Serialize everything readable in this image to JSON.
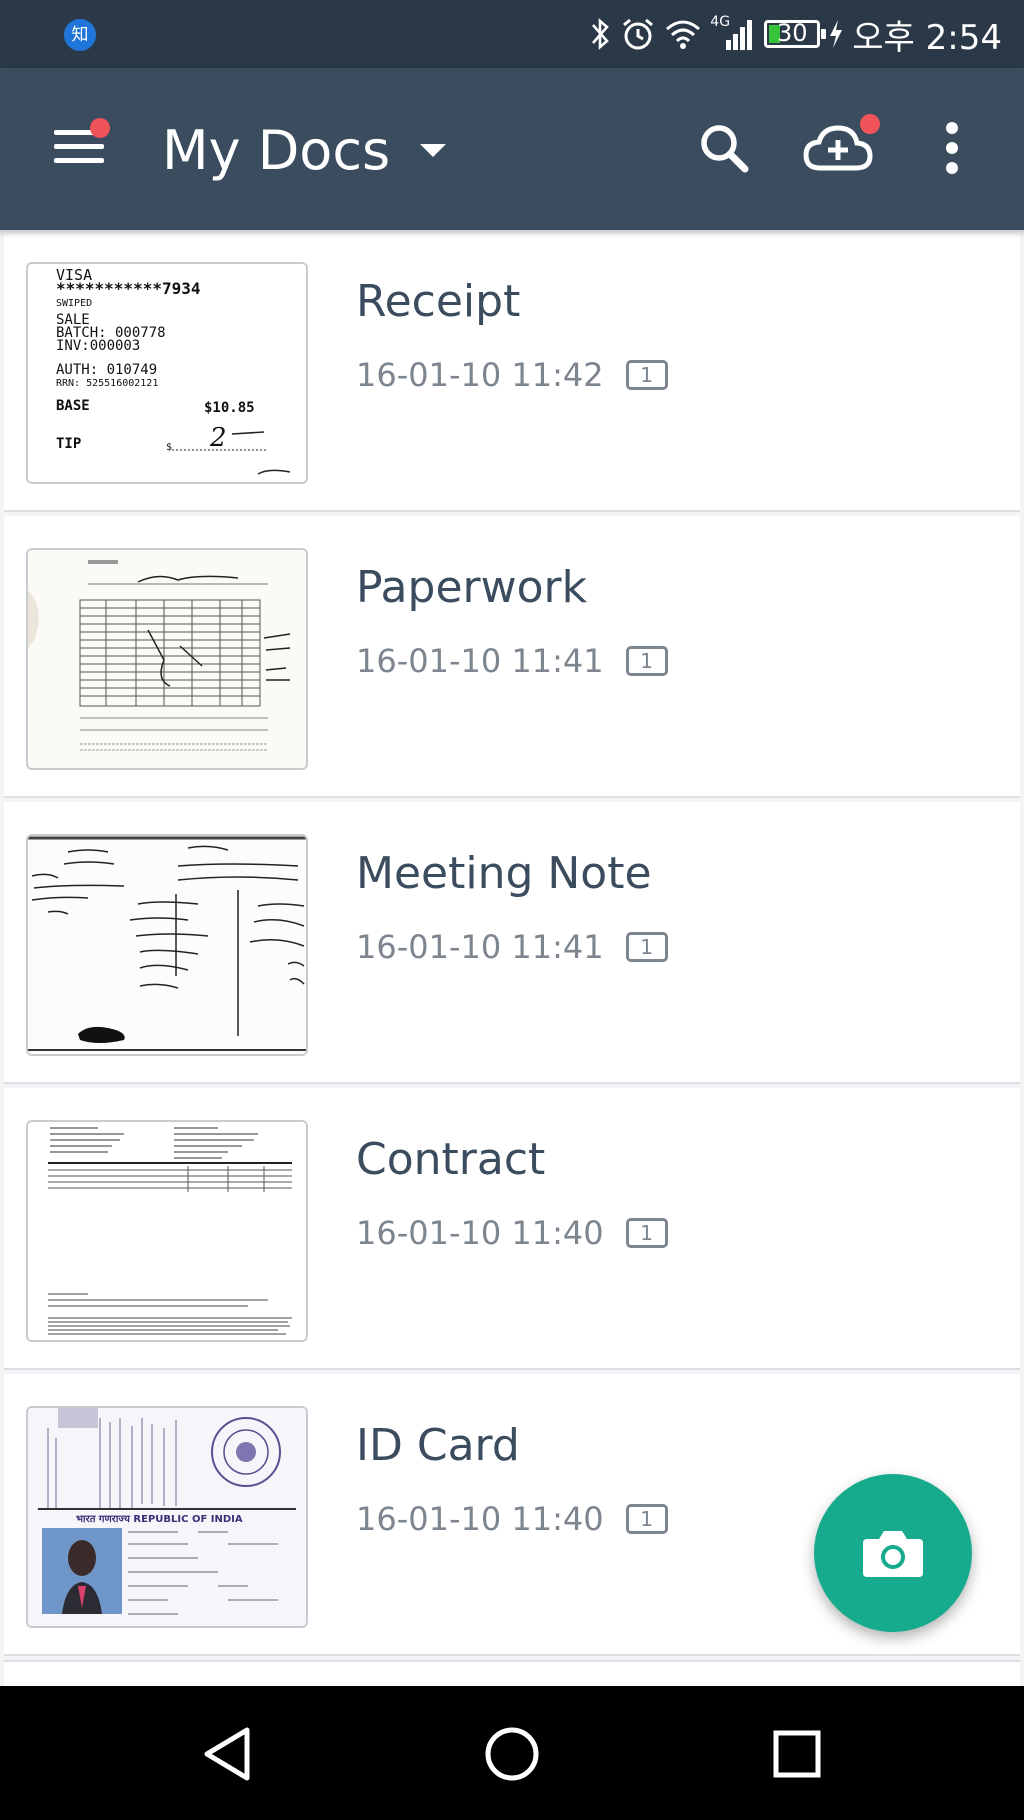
{
  "status_bar": {
    "app_icon_glyph": "知",
    "network": "4G",
    "battery": "30",
    "battery_level_percent": 30,
    "time": "오후 2:54",
    "icons": [
      "bluetooth-icon",
      "alarm-icon",
      "wifi-icon",
      "signal-icon",
      "battery-icon",
      "charging-icon"
    ]
  },
  "app_bar": {
    "title": "My Docs",
    "icons": [
      "menu-icon",
      "dropdown-caret-icon",
      "search-icon",
      "cloud-upload-icon",
      "more-vert-icon"
    ],
    "menu_has_notification": true,
    "cloud_has_notification": true
  },
  "documents": [
    {
      "title": "Receipt",
      "date": "16-01-10 11:42",
      "pages": "1",
      "thumbnail": "receipt-thumbnail"
    },
    {
      "title": "Paperwork",
      "date": "16-01-10 11:41",
      "pages": "1",
      "thumbnail": "paperwork-thumbnail"
    },
    {
      "title": "Meeting Note",
      "date": "16-01-10 11:41",
      "pages": "1",
      "thumbnail": "meeting-note-thumbnail"
    },
    {
      "title": "Contract",
      "date": "16-01-10 11:40",
      "pages": "1",
      "thumbnail": "contract-thumbnail"
    },
    {
      "title": "ID Card",
      "date": "16-01-10 11:40",
      "pages": "1",
      "thumbnail": "id-card-thumbnail"
    }
  ],
  "receipt_thumb": {
    "lines": [
      "VISA",
      "***********7934",
      "SWIPED",
      "SALE",
      "BATCH: 000778",
      "INV:000003",
      "AUTH: 010749",
      "RRN: 525516002121",
      "BASE",
      "$10.85",
      "TIP",
      "$",
      "2"
    ]
  },
  "fab": {
    "icon": "camera-icon"
  },
  "nav_bar": {
    "icons": [
      "back-icon",
      "home-icon",
      "recents-icon"
    ]
  },
  "colors": {
    "status_bar": "#2b3848",
    "app_bar": "#3b4c5f",
    "accent": "#17ab8e",
    "notification": "#f0545a",
    "title_text": "#3b4c5f",
    "meta_text": "#7d858f"
  }
}
